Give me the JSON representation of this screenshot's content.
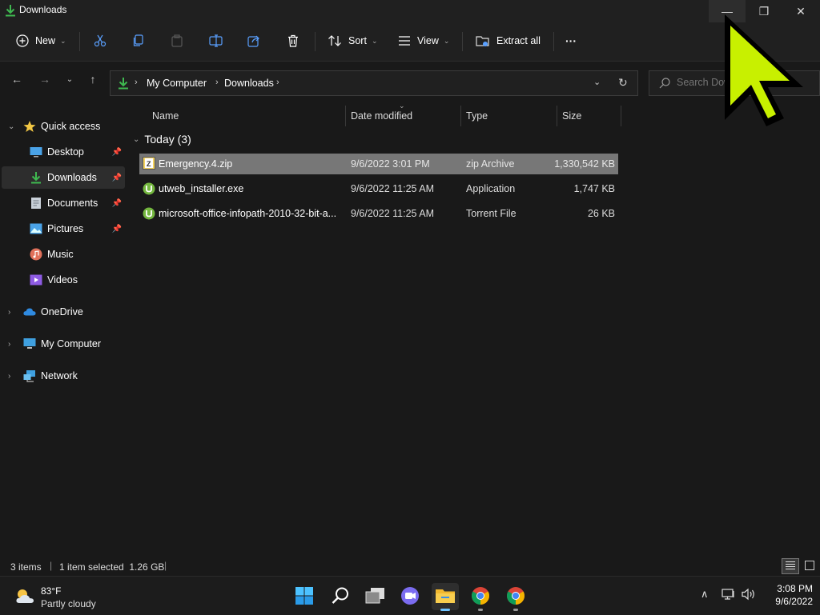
{
  "window": {
    "title": "Downloads",
    "controls": {
      "minimize": "—",
      "maximize": "❐",
      "close": "✕"
    }
  },
  "toolbar": {
    "new_label": "New",
    "sort_label": "Sort",
    "view_label": "View",
    "extract_label": "Extract all",
    "more_label": "···"
  },
  "address": {
    "breadcrumb": [
      "My Computer",
      "Downloads"
    ],
    "search_placeholder": "Search Downloads"
  },
  "sidebar": {
    "items": [
      {
        "label": "Quick access",
        "icon": "star-icon",
        "pinned": false
      },
      {
        "label": "Desktop",
        "icon": "desktop-icon",
        "pinned": true
      },
      {
        "label": "Downloads",
        "icon": "download-icon",
        "pinned": true,
        "selected": true
      },
      {
        "label": "Documents",
        "icon": "documents-icon",
        "pinned": true
      },
      {
        "label": "Pictures",
        "icon": "pictures-icon",
        "pinned": true
      },
      {
        "label": "Music",
        "icon": "music-icon",
        "pinned": false
      },
      {
        "label": "Videos",
        "icon": "videos-icon",
        "pinned": false
      },
      {
        "label": "OneDrive",
        "icon": "onedrive-icon",
        "pinned": false
      },
      {
        "label": "My Computer",
        "icon": "computer-icon",
        "pinned": false
      },
      {
        "label": "Network",
        "icon": "network-icon",
        "pinned": false
      }
    ]
  },
  "columns": [
    "Name",
    "Date modified",
    "Type",
    "Size"
  ],
  "group": {
    "label": "Today (3)"
  },
  "files": [
    {
      "name": "Emergency.4.zip",
      "date": "9/6/2022 3:01 PM",
      "type": "zip Archive",
      "size": "1,330,542 KB",
      "icon": "zip-icon",
      "selected": true
    },
    {
      "name": "utweb_installer.exe",
      "date": "9/6/2022 11:25 AM",
      "type": "Application",
      "size": "1,747 KB",
      "icon": "utorrent-icon",
      "selected": false
    },
    {
      "name": "microsoft-office-infopath-2010-32-bit-a...",
      "date": "9/6/2022 11:25 AM",
      "type": "Torrent File",
      "size": "26 KB",
      "icon": "utorrent-icon",
      "selected": false
    }
  ],
  "status": {
    "items": "3 items",
    "selection": "1 item selected  1.26 GB"
  },
  "taskbar": {
    "weather_temp": "83°F",
    "weather_desc": "Partly cloudy",
    "time": "3:08 PM",
    "date": "9/6/2022"
  },
  "colors": {
    "accent_green": "#3fb950",
    "cursor_yellow": "#c8f000",
    "selection": "#777777",
    "background": "#191919"
  }
}
